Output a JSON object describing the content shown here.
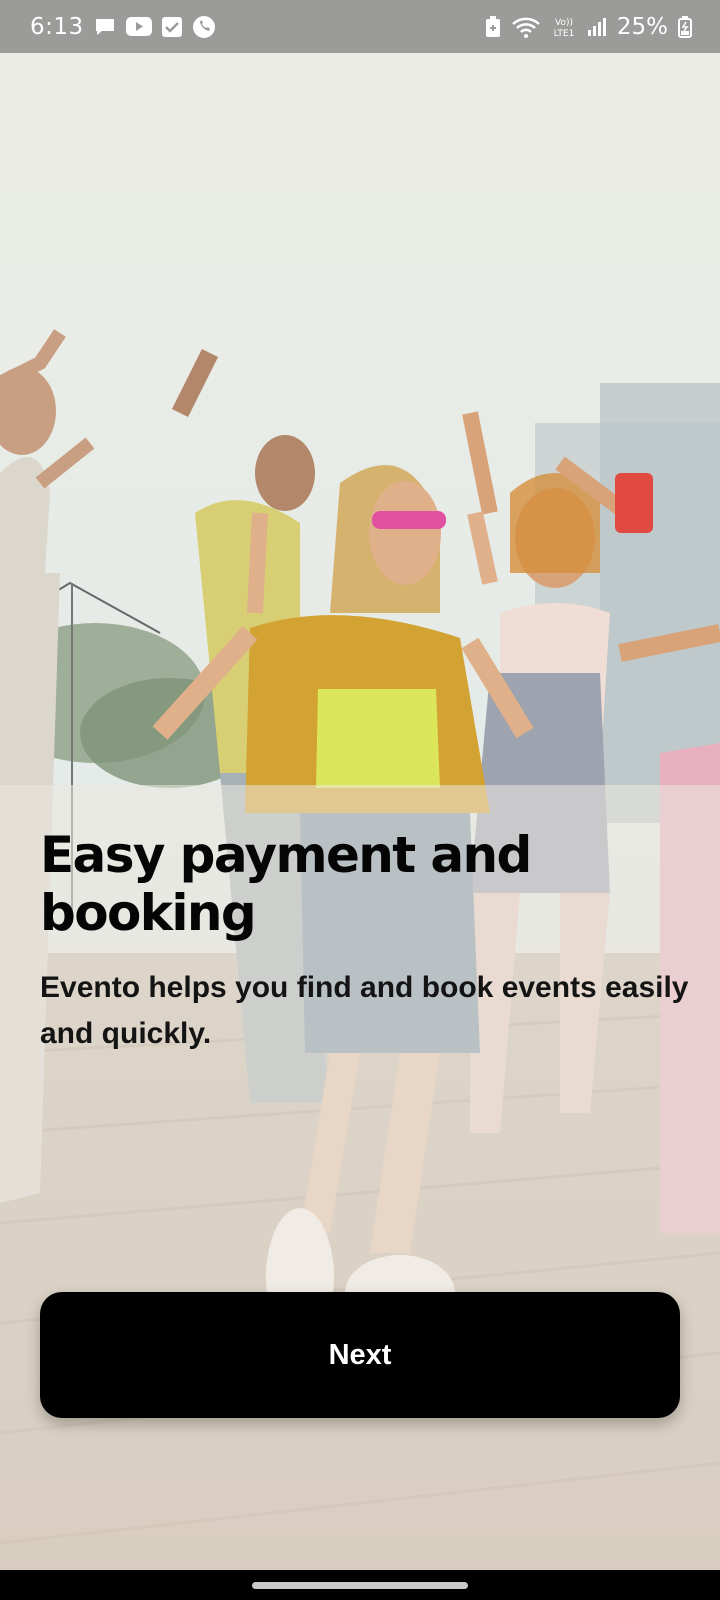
{
  "status_bar": {
    "time": "6:13",
    "battery_percent": "25%",
    "left_icons": [
      "chat-bubble-icon",
      "youtube-icon",
      "checkbox-icon",
      "viber-icon"
    ],
    "right_icons": [
      "battery-saver-icon",
      "wifi-icon",
      "volte-lte-icon",
      "signal-icon",
      "battery-charging-icon"
    ],
    "volte_text": "VoLTE1"
  },
  "onboarding": {
    "title": "Easy payment and booking",
    "subtitle": "Evento helps you find and book events easily and quickly.",
    "next_label": "Next"
  },
  "colors": {
    "button_bg": "#000000",
    "button_text": "#ffffff",
    "title_text": "#050505",
    "status_bar_bg": "#9b9b99"
  }
}
